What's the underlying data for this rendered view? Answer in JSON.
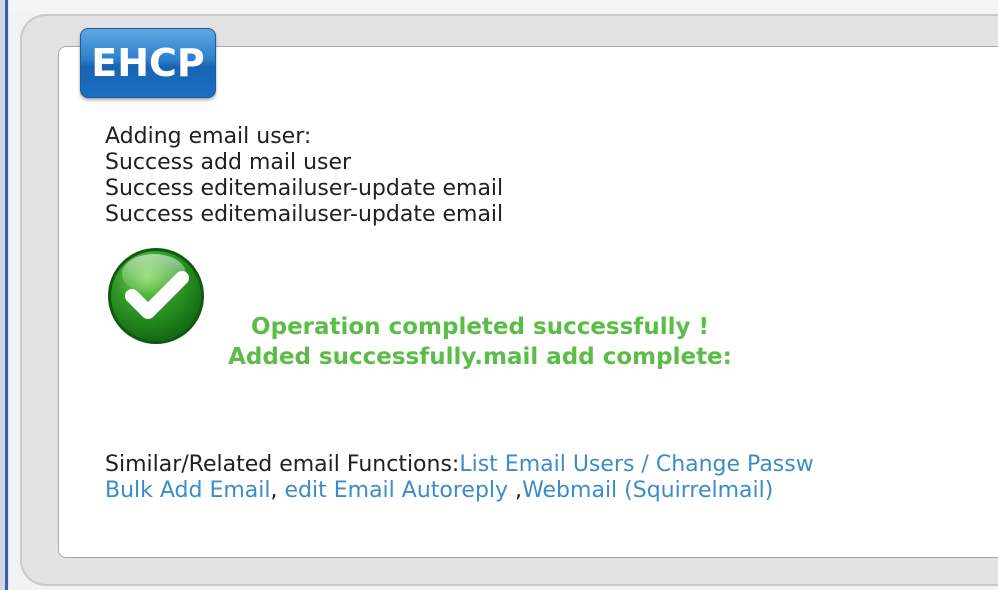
{
  "logo": {
    "text": "EHCP"
  },
  "log": {
    "lines": [
      "Adding email user:",
      "Success add mail user",
      "Success editemailuser-update email",
      "Success editemailuser-update email"
    ]
  },
  "status_icon": "green-checkmark-icon",
  "result": {
    "line1": "Operation completed successfully !",
    "line2": "Added successfully.mail add complete:"
  },
  "related": {
    "label": "Similar/Related email Functions:",
    "links": [
      {
        "text": "List Email Users / Change Passw"
      },
      {
        "text": "Bulk Add Email"
      },
      {
        "text": "edit Email Autoreply"
      },
      {
        "text": "Webmail (Squirrelmail)"
      }
    ],
    "sep1": ", ",
    "sep2": " ,"
  },
  "colors": {
    "success": "#5bbd48",
    "link": "#3b8cc9",
    "logo": "#2d7fcc"
  }
}
